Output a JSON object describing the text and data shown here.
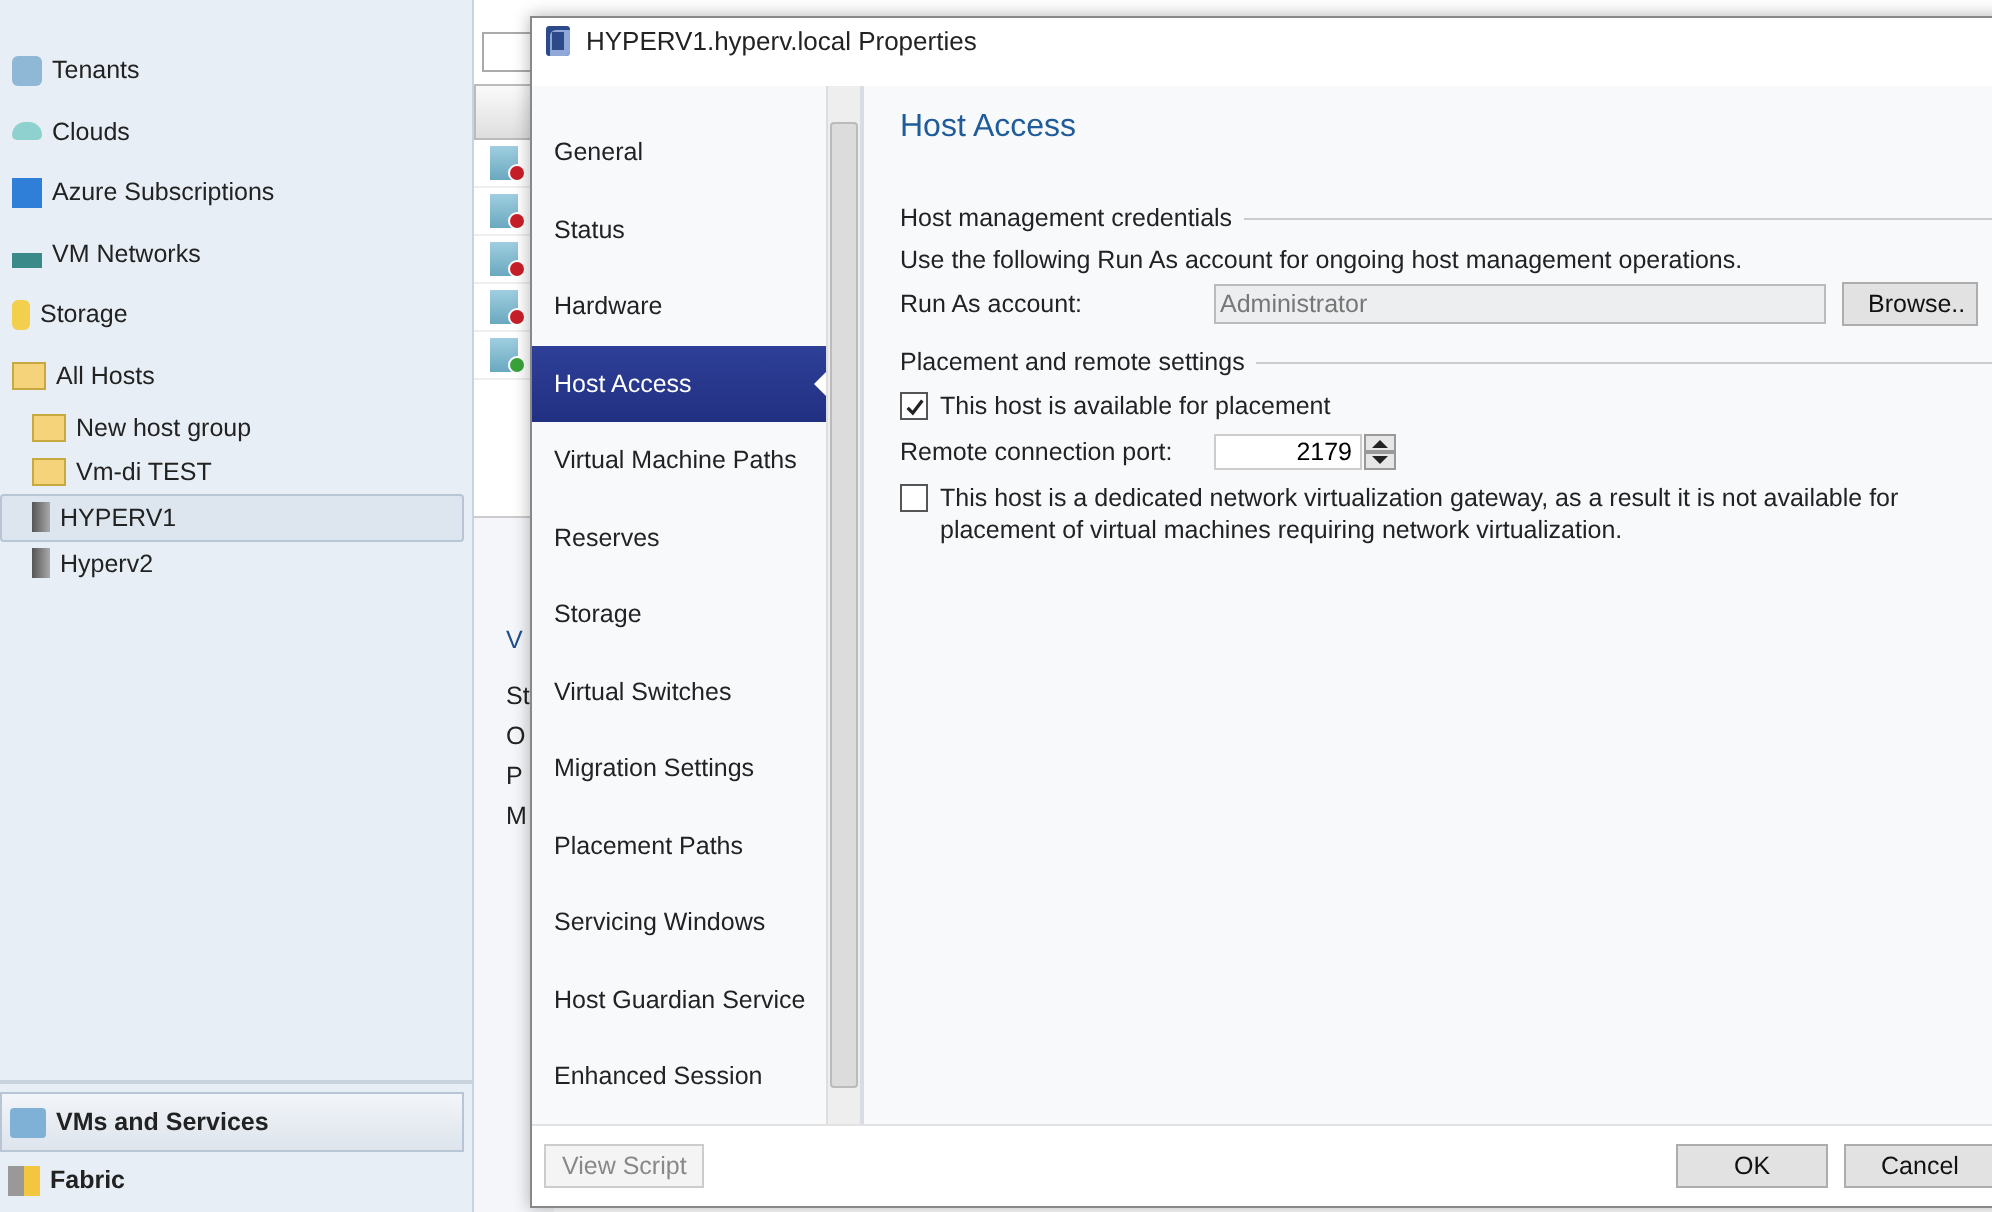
{
  "navigation": {
    "items": [
      {
        "label": "Tenants",
        "kind": "tenants",
        "selected": false
      },
      {
        "label": "Clouds",
        "kind": "cloud",
        "selected": false
      },
      {
        "label": "Azure Subscriptions",
        "kind": "azure",
        "selected": false
      },
      {
        "label": "VM Networks",
        "kind": "network",
        "selected": false
      },
      {
        "label": "Storage",
        "kind": "storage",
        "selected": false
      },
      {
        "label": "All Hosts",
        "kind": "folder",
        "selected": false,
        "children": [
          {
            "label": "New host group",
            "kind": "folder",
            "selected": false
          },
          {
            "label": "Vm-di TEST",
            "kind": "folder",
            "selected": false
          },
          {
            "label": "HYPERV1",
            "kind": "server",
            "selected": true
          },
          {
            "label": "Hyperv2",
            "kind": "server",
            "selected": false
          }
        ]
      }
    ]
  },
  "workspaces": [
    {
      "label": "VMs and Services",
      "kind": "vms",
      "selected": true
    },
    {
      "label": "Fabric",
      "kind": "fabric",
      "selected": false
    }
  ],
  "vm_list": [
    {
      "kind": "stopped"
    },
    {
      "kind": "stopped"
    },
    {
      "kind": "stopped"
    },
    {
      "kind": "stopped"
    },
    {
      "kind": "running"
    }
  ],
  "details_fragments": [
    "V",
    "St",
    "O",
    "P",
    "M"
  ],
  "dialog": {
    "title": "HYPERV1.hyperv.local Properties",
    "pages": [
      {
        "label": "General",
        "selected": false
      },
      {
        "label": "Status",
        "selected": false
      },
      {
        "label": "Hardware",
        "selected": false
      },
      {
        "label": "Host Access",
        "selected": true
      },
      {
        "label": "Virtual Machine Paths",
        "selected": false
      },
      {
        "label": "Reserves",
        "selected": false
      },
      {
        "label": "Storage",
        "selected": false
      },
      {
        "label": "Virtual Switches",
        "selected": false
      },
      {
        "label": "Migration Settings",
        "selected": false
      },
      {
        "label": "Placement Paths",
        "selected": false
      },
      {
        "label": "Servicing Windows",
        "selected": false
      },
      {
        "label": "Host Guardian Service",
        "selected": false
      },
      {
        "label": "Enhanced Session",
        "selected": false
      }
    ],
    "heading": "Host Access",
    "credentials": {
      "group": "Host management credentials",
      "description": "Use the following Run As account for ongoing host management operations.",
      "label": "Run As account:",
      "value": "Administrator",
      "browse": "Browse.."
    },
    "placement": {
      "group": "Placement and remote settings",
      "available": {
        "label": "This host is available for placement",
        "checked": true
      },
      "port_label": "Remote connection port:",
      "port": "2179",
      "gateway": {
        "label": "This host is a dedicated network virtualization gateway, as a result it is not available for placement of virtual machines requiring network virtualization.",
        "checked": false
      }
    },
    "view_script": "View Script",
    "ok": "OK",
    "cancel": "Cancel"
  }
}
